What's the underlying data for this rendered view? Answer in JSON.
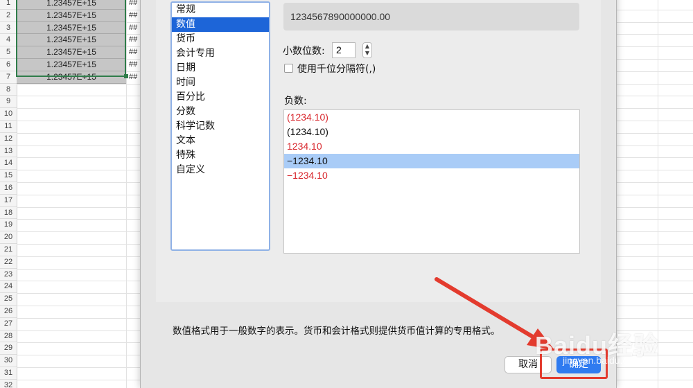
{
  "sheet": {
    "row_numbers": [
      "1",
      "2",
      "3",
      "4",
      "5",
      "6",
      "7",
      "8",
      "9",
      "10",
      "11",
      "12",
      "13",
      "14",
      "15",
      "16",
      "17",
      "18",
      "19",
      "20",
      "21",
      "22",
      "23",
      "24",
      "25",
      "26",
      "27",
      "28",
      "29",
      "30",
      "31",
      "32"
    ],
    "col_a_values": [
      "1.23457E+15",
      "1.23457E+15",
      "1.23457E+15",
      "1.23457E+15",
      "1.23457E+15",
      "1.23457E+15",
      "1.23457E+15"
    ],
    "col_b_overflow": "##",
    "selection_color": "#2f7d4a"
  },
  "dialog": {
    "categories": [
      "常规",
      "数值",
      "货币",
      "会计专用",
      "日期",
      "时间",
      "百分比",
      "分数",
      "科学记数",
      "文本",
      "特殊",
      "自定义"
    ],
    "selected_category": "数值",
    "sample_value": "1234567890000000.00",
    "decimals_label": "小数位数:",
    "decimals_value": "2",
    "thousands_label": "使用千位分隔符(,)",
    "negative_label": "负数:",
    "negative_options": [
      {
        "text": "(1234.10)",
        "color": "red"
      },
      {
        "text": "(1234.10)",
        "color": "black"
      },
      {
        "text": "1234.10",
        "color": "red"
      },
      {
        "text": "−1234.10",
        "color": "black",
        "selected": true
      },
      {
        "text": "−1234.10",
        "color": "red"
      }
    ],
    "description": "数值格式用于一般数字的表示。货币和会计格式则提供货币值计算的专用格式。",
    "cancel_label": "取消",
    "ok_label": "确定",
    "accent_color": "#2f7bf0"
  },
  "annotation": {
    "color": "#e33b2e"
  },
  "watermark": {
    "text": "Baidu经验",
    "sub": "jingyan.baidu.com"
  }
}
